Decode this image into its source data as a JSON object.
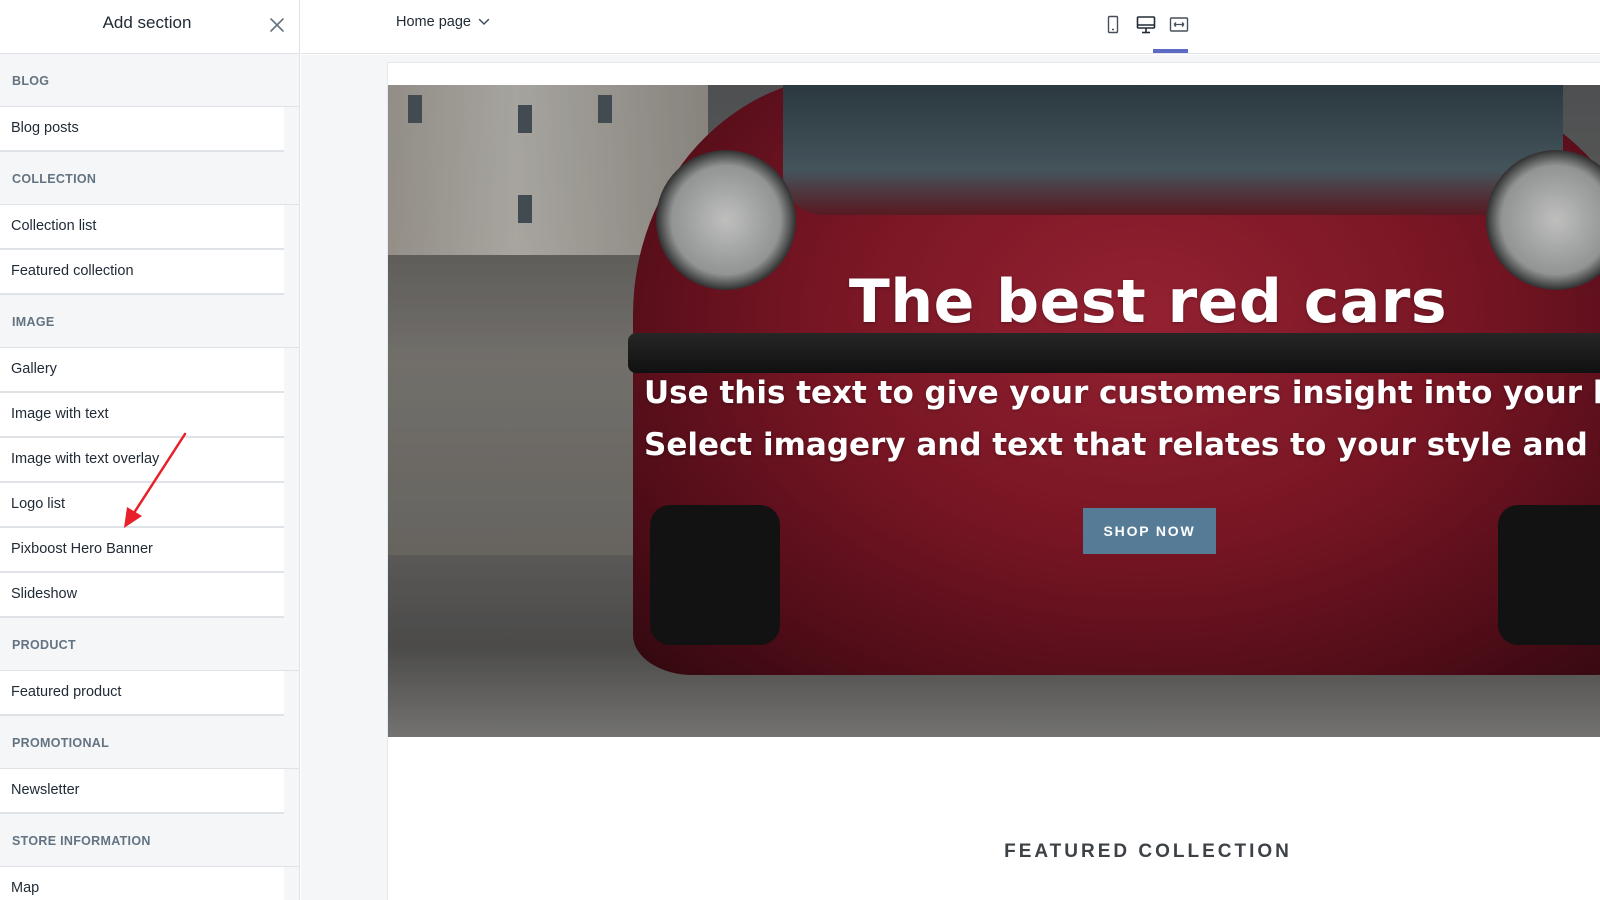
{
  "sidebar": {
    "title": "Add section",
    "groups": [
      {
        "heading": "BLOG",
        "items": [
          "Blog posts"
        ]
      },
      {
        "heading": "COLLECTION",
        "items": [
          "Collection list",
          "Featured collection"
        ]
      },
      {
        "heading": "IMAGE",
        "items": [
          "Gallery",
          "Image with text",
          "Image with text overlay",
          "Logo list",
          "Pixboost Hero Banner",
          "Slideshow"
        ]
      },
      {
        "heading": "PRODUCT",
        "items": [
          "Featured product"
        ]
      },
      {
        "heading": "PROMOTIONAL",
        "items": [
          "Newsletter"
        ]
      },
      {
        "heading": "STORE INFORMATION",
        "items": [
          "Map"
        ]
      }
    ]
  },
  "topbar": {
    "page_select": "Home page",
    "views": [
      "mobile-view-icon",
      "desktop-view-icon",
      "full-width-view-icon"
    ],
    "active_view": "desktop-view-icon"
  },
  "preview": {
    "hero": {
      "title": "The best red cars",
      "subtitle_line1": "Use this text to give your customers insight into your br",
      "subtitle_line2": "Select imagery and text that relates to your style and s",
      "cta": "SHOP NOW"
    },
    "featured_heading": "FEATURED COLLECTION"
  },
  "colors": {
    "accent": "#5c6ac4",
    "cta": "#557b97",
    "annotation": "#e8202a"
  }
}
